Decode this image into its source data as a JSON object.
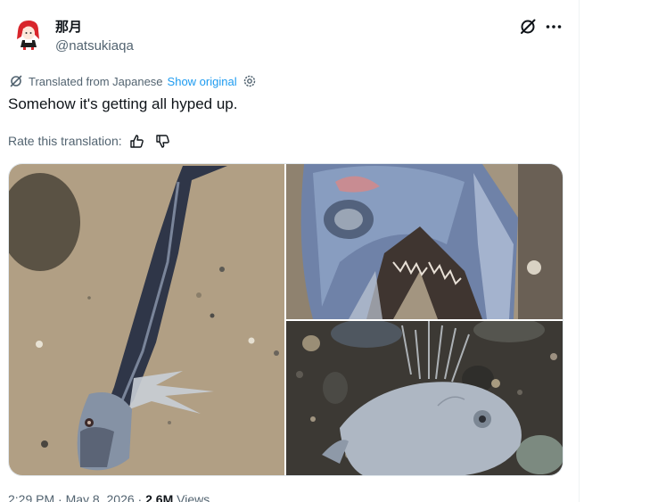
{
  "user": {
    "display_name": "那月",
    "handle": "@natsukiaqa"
  },
  "translation": {
    "label": "Translated from Japanese",
    "show_original": "Show original"
  },
  "tweet": {
    "text": "Somehow it's getting all hyped up."
  },
  "rating": {
    "label": "Rate this translation:"
  },
  "meta": {
    "time": "2:29 PM",
    "separator": "·",
    "date": "May 8, 2026",
    "views_count": "2.6M",
    "views_label": "Views"
  },
  "icons": {
    "grok": "grok-icon",
    "more": "more-dots-icon",
    "translate": "translate-icon",
    "settings": "gear-icon",
    "thumb_up": "thumb-up-icon",
    "thumb_down": "thumb-down-icon"
  },
  "colors": {
    "text": "#0f1419",
    "secondary": "#536471",
    "link": "#1d9bf0"
  }
}
